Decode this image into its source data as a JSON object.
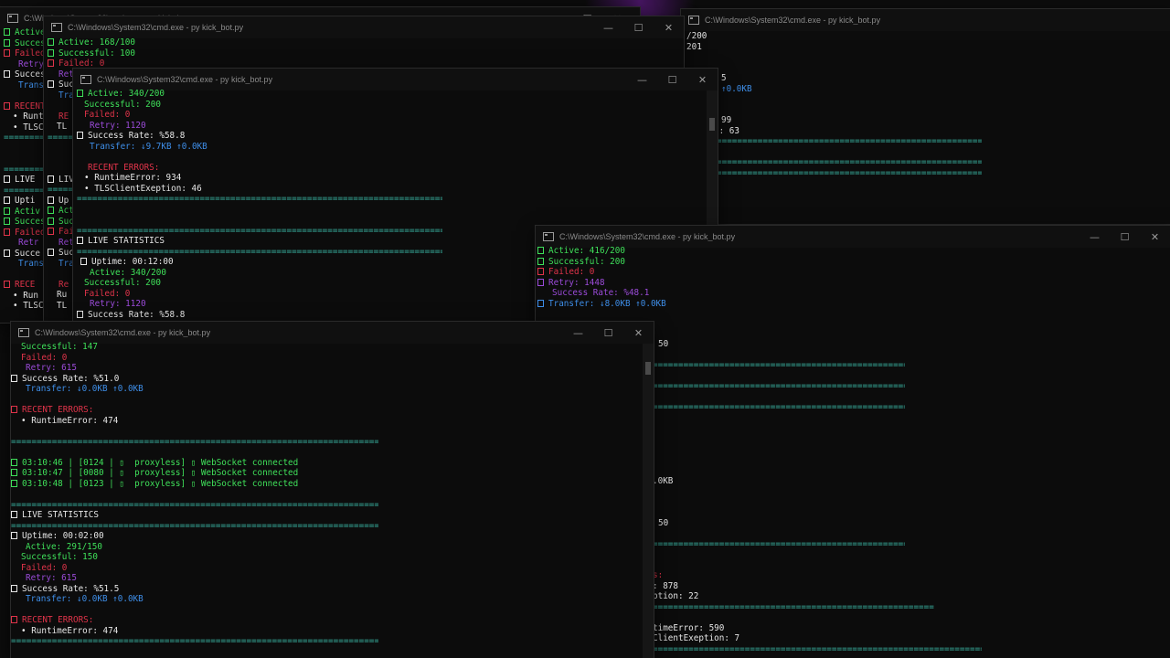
{
  "windows": {
    "title": "C:\\Windows\\System32\\cmd.exe - py  kick_bot.py",
    "controls": {
      "minimize": "—",
      "maximize": "☐",
      "close": "✕"
    }
  },
  "win1": {
    "lines": [
      "Active: 1",
      "Successf",
      "Failed:",
      "Retry",
      "Success",
      "Transf",
      "RECENT",
      "Runt",
      "TLSC",
      "LIVE",
      "Upti",
      "Activ",
      "Succes",
      "Failed",
      "Retr",
      "Succe",
      "Trans",
      "RECE",
      "Run",
      "TLSC"
    ]
  },
  "win2": {
    "lines": [
      "Active: 168/100",
      "Successful: 100",
      "Failed: 0",
      "Retr",
      "Suc",
      "Tra",
      "RE",
      "TL",
      "LIV",
      "Up",
      "Act",
      "Succ",
      "Fail",
      "Retr",
      "Suc",
      "Tra",
      "Re",
      "Ru",
      "TL"
    ]
  },
  "win3": {
    "lines": [
      "/200",
      "201",
      "5",
      "↑0.0KB",
      "99",
      "n: 63"
    ]
  },
  "win4": {
    "active": "Active: 340/200",
    "successful": "Successful: 200",
    "failed": "Failed: 0",
    "retry": "Retry: 1120",
    "success_rate": "Success Rate: %58.8",
    "transfer": "Transfer: ↓9.7KB ↑0.0KB",
    "recent_errors": "RECENT ERRORS:",
    "error1": "• RuntimeError: 934",
    "error2": "• TLSClientExeption: 46",
    "live": "LIVE STATISTICS",
    "uptime": "Uptime: 00:12:00",
    "active2": "Active: 340/200",
    "successful2": "Successful: 200",
    "failed2": "Failed: 0",
    "retry2": "Retry: 1120",
    "success_rate2": "Success Rate: %58.8"
  },
  "win5": {
    "active": "Active: 416/200",
    "successful": "Successful: 200",
    "failed": "Failed: 0",
    "retry": "Retry: 1448",
    "success_rate": "Success Rate: %48.1",
    "transfer": "Transfer: ↓8.0KB ↑0.0KB",
    "behind": [
      "50",
      ".0KB",
      "50",
      "s:",
      ": 878",
      "ption: 22",
      "timeError: 590",
      "ClientExeption: 7"
    ]
  },
  "win6": {
    "successful": "Successful: 147",
    "failed": "Failed: 0",
    "retry": "Retry: 615",
    "success_rate": "Success Rate: %51.0",
    "transfer": "Transfer: ↓0.0KB ↑0.0KB",
    "recent_errors": "RECENT ERRORS:",
    "error1": "• RuntimeError: 474",
    "log": [
      "03:10:46 | [0124 | ▯  proxyless] ▯ WebSocket connected",
      "03:10:47 | [0080 | ▯  proxyless] ▯ WebSocket connected",
      "03:10:48 | [0123 | ▯  proxyless] ▯ WebSocket connected"
    ],
    "live": "LIVE STATISTICS",
    "uptime": "Uptime: 00:02:00",
    "active": "Active: 291/150",
    "successful2": "Successful: 150",
    "failed2": "Failed: 0",
    "retry2": "Retry: 615",
    "success_rate2": "Success Rate: %51.5",
    "transfer2": "Transfer: ↓0.0KB ↑0.0KB",
    "recent_errors2": "RECENT ERRORS:",
    "error2": "• RuntimeError: 474"
  },
  "separator": "============================================================================================"
}
